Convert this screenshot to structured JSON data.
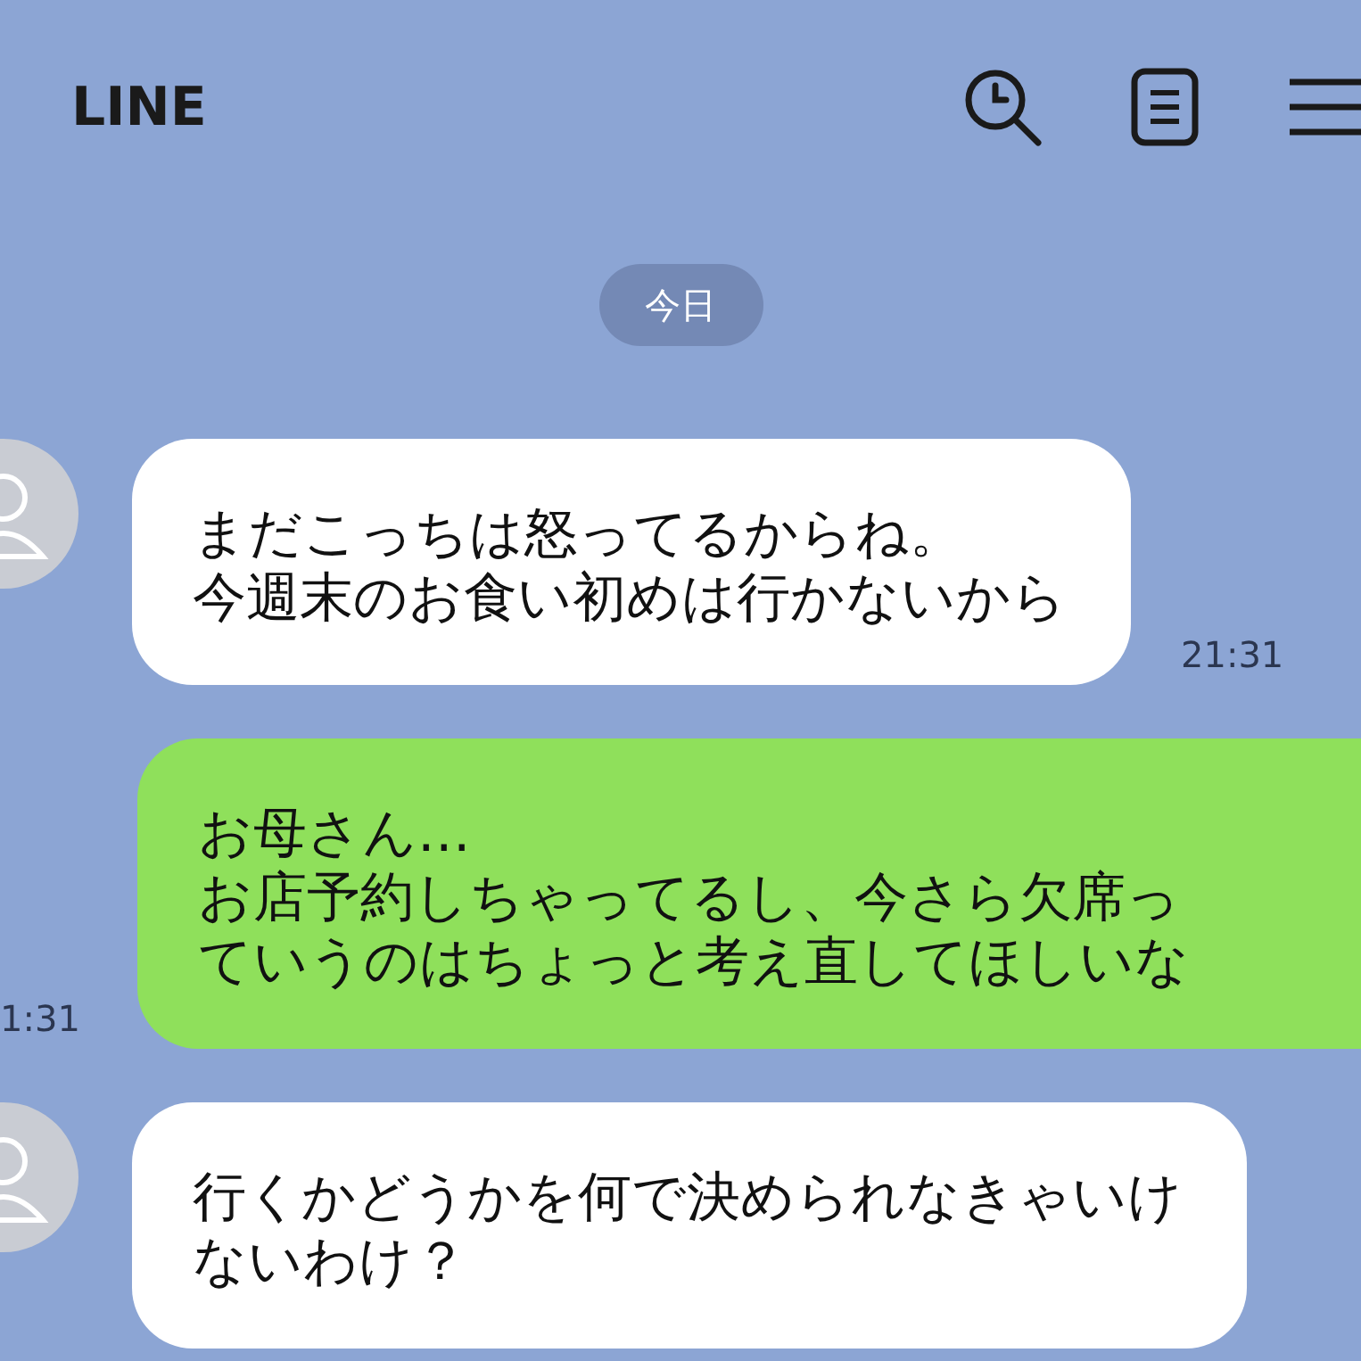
{
  "header": {
    "title": "LINE"
  },
  "date_label": "今日",
  "messages": [
    {
      "kind": "received",
      "lines": [
        "まだこっちは怒ってるからね。",
        "今週末のお食い初めは行かないから"
      ],
      "time": "21:31"
    },
    {
      "kind": "sent",
      "lines": [
        "お母さん…",
        "お店予約しちゃってるし、今さら欠席っ",
        "ていうのはちょっと考え直してほしいな"
      ],
      "time": "1:31"
    },
    {
      "kind": "received",
      "lines": [
        "行くかどうかを何で決められなきゃいけ",
        "ないわけ？"
      ]
    }
  ]
}
